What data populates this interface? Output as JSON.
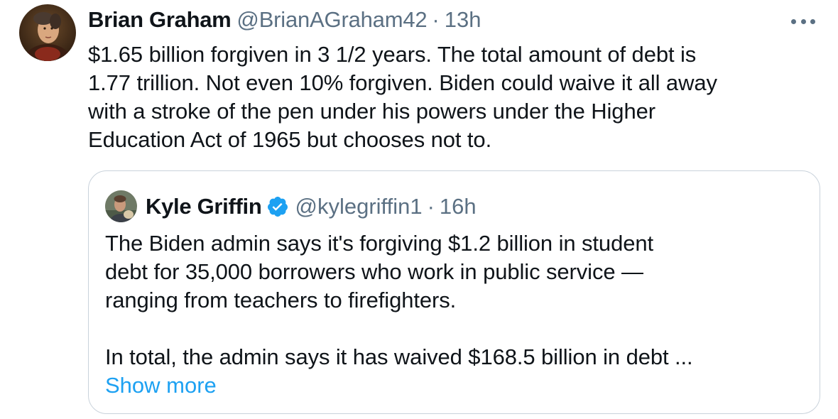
{
  "tweet": {
    "author_name": "Brian Graham",
    "author_handle": "@BrianAGraham42",
    "separator": "·",
    "time": "13h",
    "text": "$1.65 billion forgiven in 3 1/2 years.  The total amount of debt is\n1.77 trillion. Not even 10% forgiven. Biden could waive it all away\nwith a stroke of the pen under his powers under the Higher\nEducation Act of 1965 but chooses not to.",
    "more_icon": "more-options-icon"
  },
  "quoted_tweet": {
    "author_name": "Kyle Griffin",
    "verified_icon": "verified-badge-icon",
    "author_handle": "@kylegriffin1",
    "separator": "·",
    "time": "16h",
    "text": "The Biden admin says it's forgiving $1.2 billion in student\ndebt for 35,000 borrowers who work in public service —\nranging from teachers to firefighters.\n\nIn total, the admin says it has waived $168.5 billion in debt ...",
    "show_more_label": "Show more"
  },
  "colors": {
    "text_primary": "#0f1419",
    "text_secondary": "#5b7083",
    "link_blue": "#1da1f2",
    "card_border": "#c9d2db"
  }
}
